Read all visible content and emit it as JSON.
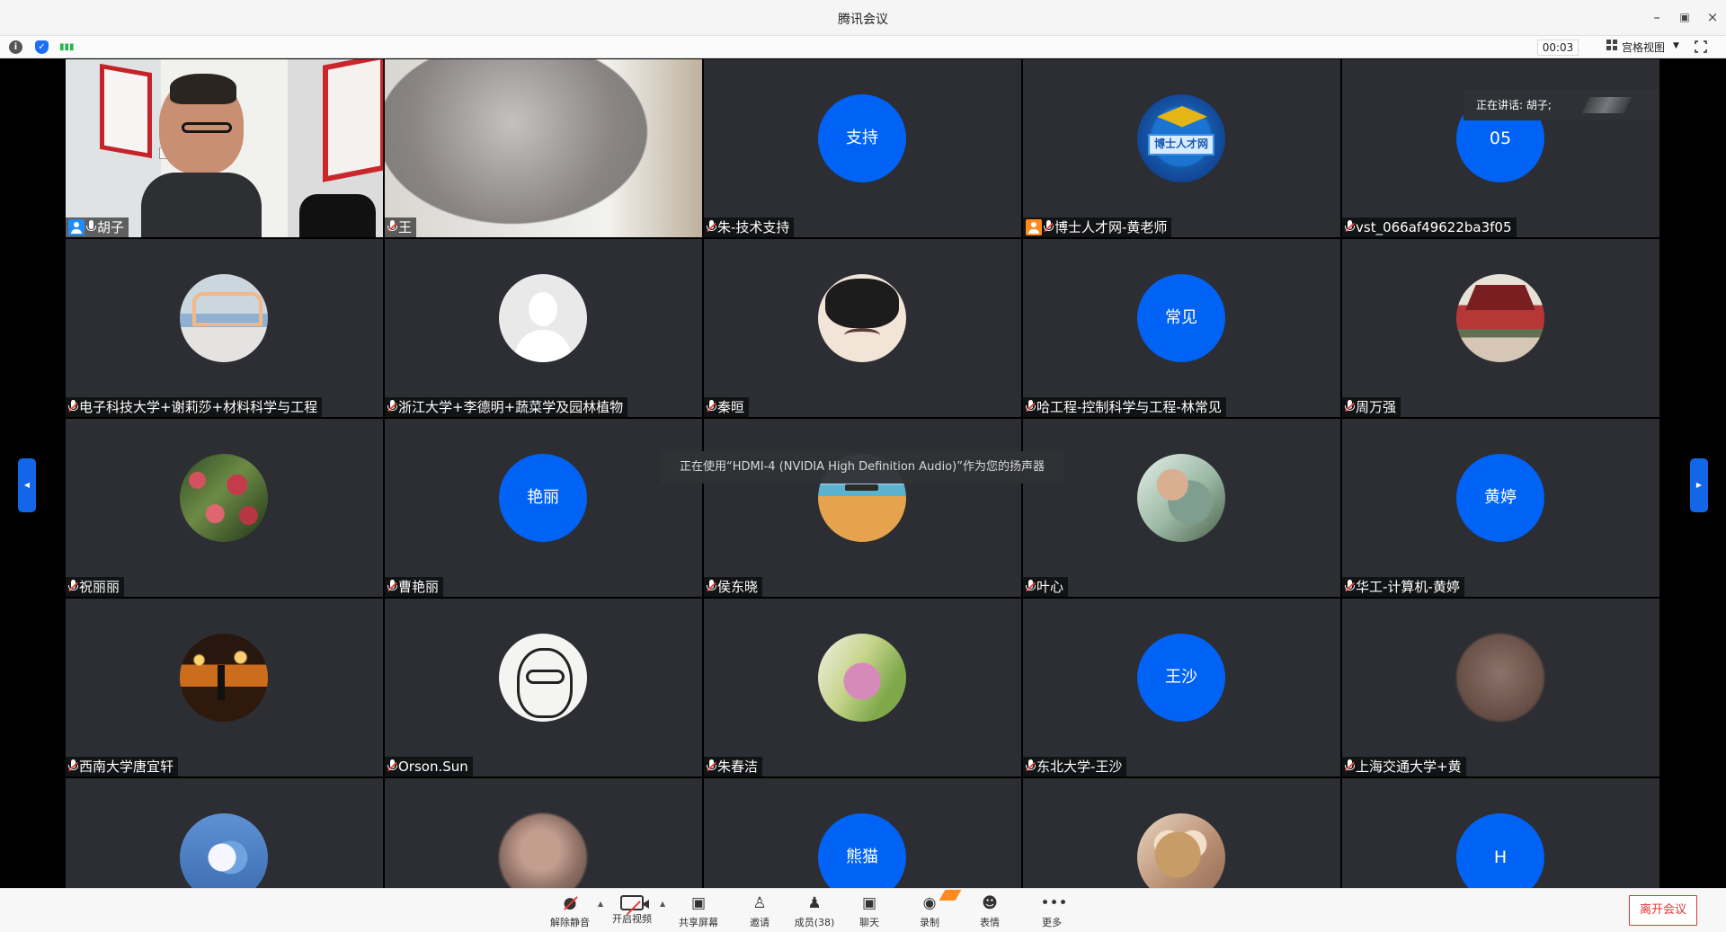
{
  "window": {
    "title": "腾讯会议",
    "controls": [
      "minimize",
      "restore",
      "close"
    ]
  },
  "top_bar": {
    "timer": "00:03",
    "view_mode": "宫格视图",
    "icons": [
      "info-icon",
      "shield-icon",
      "signal-icon",
      "fullscreen-icon"
    ]
  },
  "active_speaker": {
    "label": "正在讲话: 胡子;"
  },
  "notification": {
    "text": "正在使用“HDMI-4 (NVIDIA High Definition Audio)”作为您的扬声器"
  },
  "participants": [
    {
      "name": "胡子",
      "avatar_text": "",
      "type": "video",
      "badge": "host",
      "mic": "on"
    },
    {
      "name": "王",
      "avatar_text": "",
      "type": "blurred-video",
      "badge": "",
      "mic": "muted"
    },
    {
      "name": "朱-技术支持",
      "avatar_text": "支持",
      "type": "blue-avatar",
      "badge": "",
      "mic": "muted"
    },
    {
      "name": "博士人才网-黄老师",
      "avatar_text": "博士人才网",
      "type": "logo",
      "badge": "cohost",
      "mic": "muted"
    },
    {
      "name": "vst_066af49622ba3f05",
      "avatar_text": "05",
      "type": "blue-avatar",
      "badge": "",
      "mic": "muted"
    },
    {
      "name": "电子科技大学+谢莉莎+材料科学与工程",
      "avatar_text": "",
      "type": "photo-classroom",
      "badge": "",
      "mic": "muted"
    },
    {
      "name": "浙江大学+李德明+蔬菜学及园林植物",
      "avatar_text": "",
      "type": "default-person",
      "badge": "",
      "mic": "muted"
    },
    {
      "name": "秦晅",
      "avatar_text": "",
      "type": "photo-child",
      "badge": "",
      "mic": "muted"
    },
    {
      "name": "哈工程-控制科学与工程-林常见",
      "avatar_text": "常见",
      "type": "blue-avatar",
      "badge": "",
      "mic": "muted"
    },
    {
      "name": "周万强",
      "avatar_text": "",
      "type": "photo-temple",
      "badge": "",
      "mic": "muted"
    },
    {
      "name": "祝丽丽",
      "avatar_text": "",
      "type": "photo-lychee",
      "badge": "",
      "mic": "muted"
    },
    {
      "name": "曹艳丽",
      "avatar_text": "艳丽",
      "type": "blue-avatar",
      "badge": "",
      "mic": "muted"
    },
    {
      "name": "侯东晓",
      "avatar_text": "",
      "type": "photo-ocean",
      "badge": "",
      "mic": "muted"
    },
    {
      "name": "叶心",
      "avatar_text": "",
      "type": "photo-couple",
      "badge": "",
      "mic": "muted"
    },
    {
      "name": "华工-计算机-黄婷",
      "avatar_text": "黄婷",
      "type": "blue-avatar",
      "badge": "",
      "mic": "muted"
    },
    {
      "name": "西南大学唐宜轩",
      "avatar_text": "",
      "type": "photo-night",
      "badge": "",
      "mic": "muted"
    },
    {
      "name": "Orson.Sun",
      "avatar_text": "",
      "type": "photo-sketch",
      "badge": "",
      "mic": "muted"
    },
    {
      "name": "朱春洁",
      "avatar_text": "",
      "type": "photo-swing",
      "badge": "",
      "mic": "muted"
    },
    {
      "name": "东北大学-王沙",
      "avatar_text": "王沙",
      "type": "blue-avatar",
      "badge": "",
      "mic": "muted"
    },
    {
      "name": "上海交通大学+黄",
      "avatar_text": "",
      "type": "photo-blur-brown",
      "badge": "",
      "mic": "muted"
    },
    {
      "name": "",
      "avatar_text": "",
      "type": "photo-moon",
      "badge": "",
      "mic": ""
    },
    {
      "name": "",
      "avatar_text": "",
      "type": "photo-blur-face",
      "badge": "",
      "mic": ""
    },
    {
      "name": "",
      "avatar_text": "熊猫",
      "type": "blue-avatar",
      "badge": "",
      "mic": ""
    },
    {
      "name": "",
      "avatar_text": "",
      "type": "photo-lion",
      "badge": "",
      "mic": ""
    },
    {
      "name": "",
      "avatar_text": "H",
      "type": "blue-avatar",
      "badge": "",
      "mic": ""
    }
  ],
  "toolbar": {
    "unmute": "解除静音",
    "start_video": "开启视频",
    "share_screen": "共享屏幕",
    "invite": "邀请",
    "members": "成员(38)",
    "chat": "聊天",
    "record": "录制",
    "reactions": "表情",
    "more": "更多",
    "leave": "离开会议"
  }
}
